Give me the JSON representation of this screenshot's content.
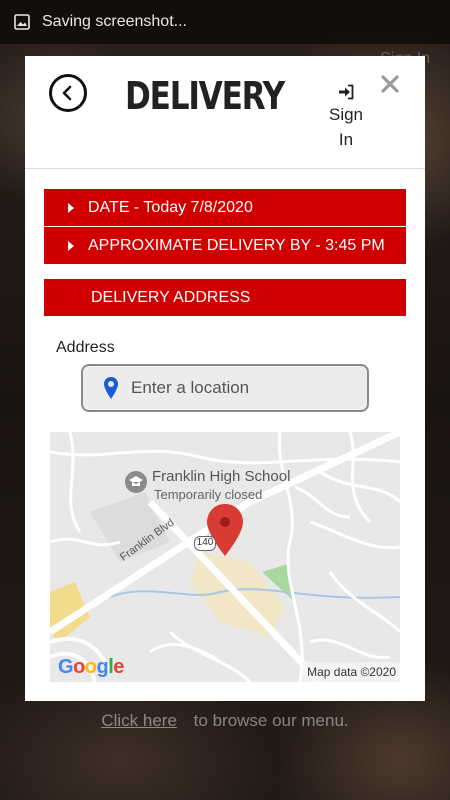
{
  "status_bar": {
    "notification": "Saving screenshot..."
  },
  "background": {
    "sign_in_hint": "Sign In"
  },
  "modal": {
    "title": "DELIVERY",
    "sign_in_label": "Sign In",
    "date_label": "DATE - Today 7/8/2020",
    "approx_label": "APPROXIMATE DELIVERY BY - 3:45 PM",
    "address_section": "DELIVERY ADDRESS",
    "address_label": "Address",
    "address_placeholder": "Enter a location",
    "address_value": ""
  },
  "map": {
    "school_name": "Franklin High School",
    "school_status": "Temporarily closed",
    "road_name": "Franklin Blvd",
    "route_number": "140",
    "attribution": "Map data ©2020",
    "logo_letters": [
      "G",
      "o",
      "o",
      "g",
      "l",
      "e"
    ]
  },
  "footer": {
    "link_text": "Click here",
    "rest_text": "to browse our menu."
  },
  "colors": {
    "accent": "#d10000",
    "pin": "#d83a34",
    "location_icon": "#1a5bd6"
  },
  "icons": [
    "image-icon",
    "back-arrow-icon",
    "sign-in-icon",
    "close-icon",
    "location-pin-icon",
    "map-marker-icon"
  ]
}
